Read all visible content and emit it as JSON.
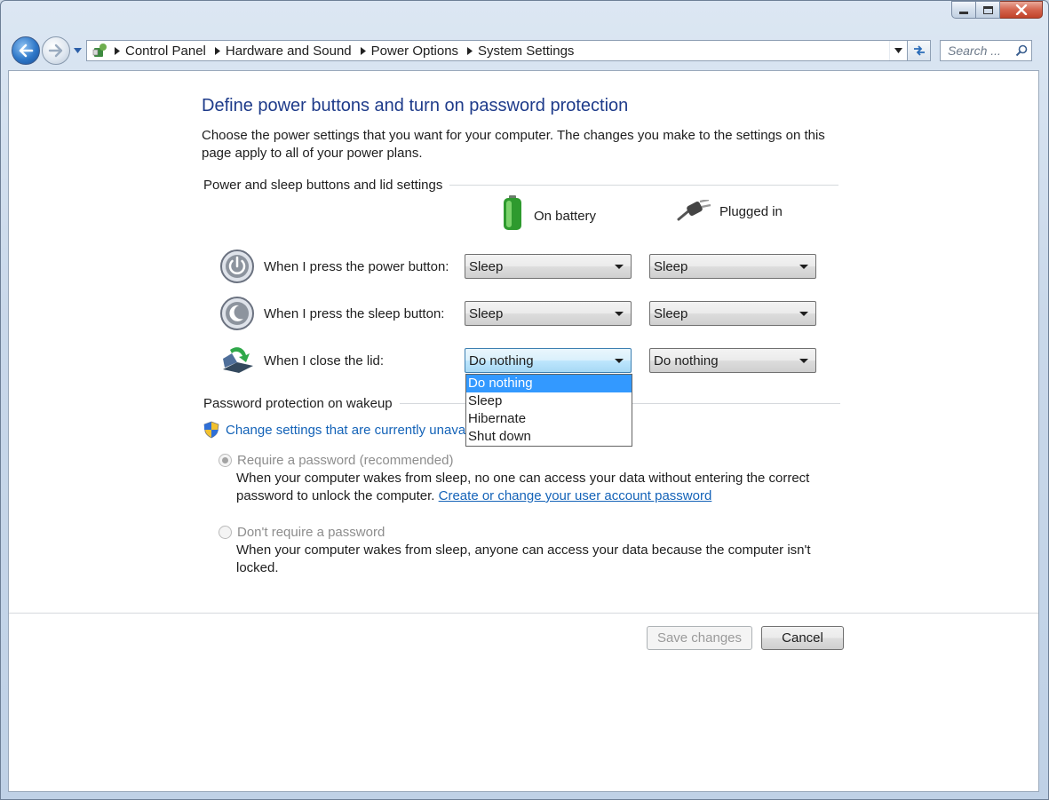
{
  "nav": {
    "breadcrumbs": [
      "Control Panel",
      "Hardware and Sound",
      "Power Options",
      "System Settings"
    ],
    "search_placeholder": "Search ..."
  },
  "page": {
    "title": "Define power buttons and turn on password protection",
    "intro": "Choose the power settings that you want for your computer. The changes you make to the settings on this page apply to all of your power plans."
  },
  "buttons_section": {
    "heading": "Power and sleep buttons and lid settings",
    "col_battery": "On battery",
    "col_plugged": "Plugged in",
    "rows": [
      {
        "label": "When I press the power button:",
        "battery": "Sleep",
        "plugged": "Sleep"
      },
      {
        "label": "When I press the sleep button:",
        "battery": "Sleep",
        "plugged": "Sleep"
      },
      {
        "label": "When I close the lid:",
        "battery": "Do nothing",
        "plugged": "Do nothing"
      }
    ],
    "dropdown_options": [
      "Do nothing",
      "Sleep",
      "Hibernate",
      "Shut down"
    ],
    "dropdown_selected": "Do nothing"
  },
  "password_section": {
    "heading": "Password protection on wakeup",
    "change_link": "Change settings that are currently unavail",
    "require": {
      "label": "Require a password (recommended)",
      "desc": "When your computer wakes from sleep, no one can access your data without entering the correct password to unlock the computer.",
      "link": "Create or change your user account password",
      "checked": true
    },
    "dont_require": {
      "label": "Don't require a password",
      "desc": "When your computer wakes from sleep, anyone can access your data because the computer isn't locked.",
      "checked": false
    }
  },
  "footer": {
    "save_label": "Save changes",
    "cancel_label": "Cancel"
  },
  "colors": {
    "title_blue": "#1e3b8a",
    "link_blue": "#1463b8",
    "selection_blue": "#3399ff"
  }
}
